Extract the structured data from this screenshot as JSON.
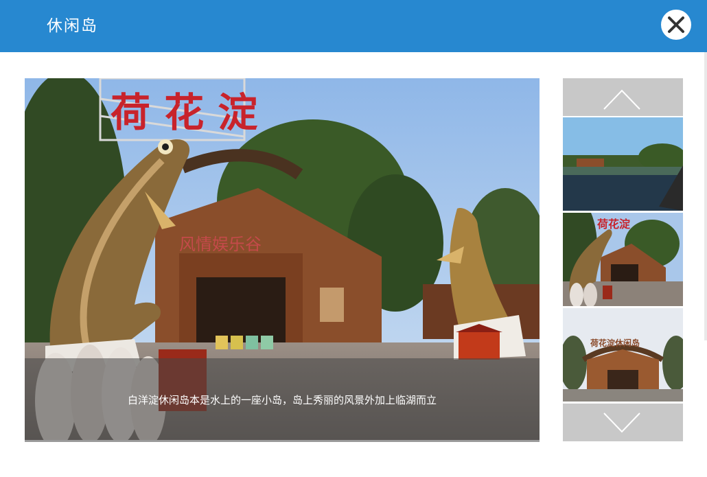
{
  "dialog": {
    "title": "休闲岛",
    "close_icon": "close-icon",
    "accent_color": "#2788d0"
  },
  "main_photo": {
    "sign_text": "风情娱乐谷",
    "caption": "白洋淀休闲岛本是水上的一座小岛，岛上秀丽的风景外加上临湖而立"
  },
  "thumbnails": {
    "up_icon": "chevron-up-icon",
    "down_icon": "chevron-down-icon",
    "items": [
      {
        "subject": "lake-scene"
      },
      {
        "subject": "fish-gate-scene"
      },
      {
        "subject": "wooden-gate-scene"
      }
    ]
  }
}
